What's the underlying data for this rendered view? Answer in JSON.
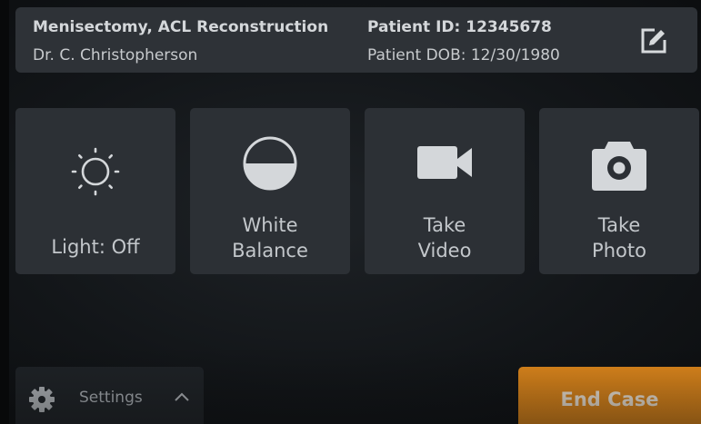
{
  "header": {
    "procedure": "Menisectomy, ACL Reconstruction",
    "doctor": "Dr. C. Christopherson",
    "patient_id": "Patient ID: 12345678",
    "patient_dob": "Patient DOB: 12/30/1980",
    "edit_icon": "edit-icon"
  },
  "tiles": [
    {
      "icon": "sun-icon",
      "line1": "",
      "line2": "Light: Off"
    },
    {
      "icon": "white-balance-icon",
      "line1": "White",
      "line2": "Balance"
    },
    {
      "icon": "video-camera-icon",
      "line1": "Take",
      "line2": "Video"
    },
    {
      "icon": "camera-icon",
      "line1": "Take",
      "line2": "Photo"
    }
  ],
  "footer": {
    "settings_label": "Settings",
    "settings_icon": "gear-icon",
    "settings_chevron": "chevron-up-icon",
    "end_case_label": "End Case"
  },
  "colors": {
    "background": "#121518",
    "card": "#2c3035",
    "header": "#2e3237",
    "accent": "#e38a1c"
  }
}
